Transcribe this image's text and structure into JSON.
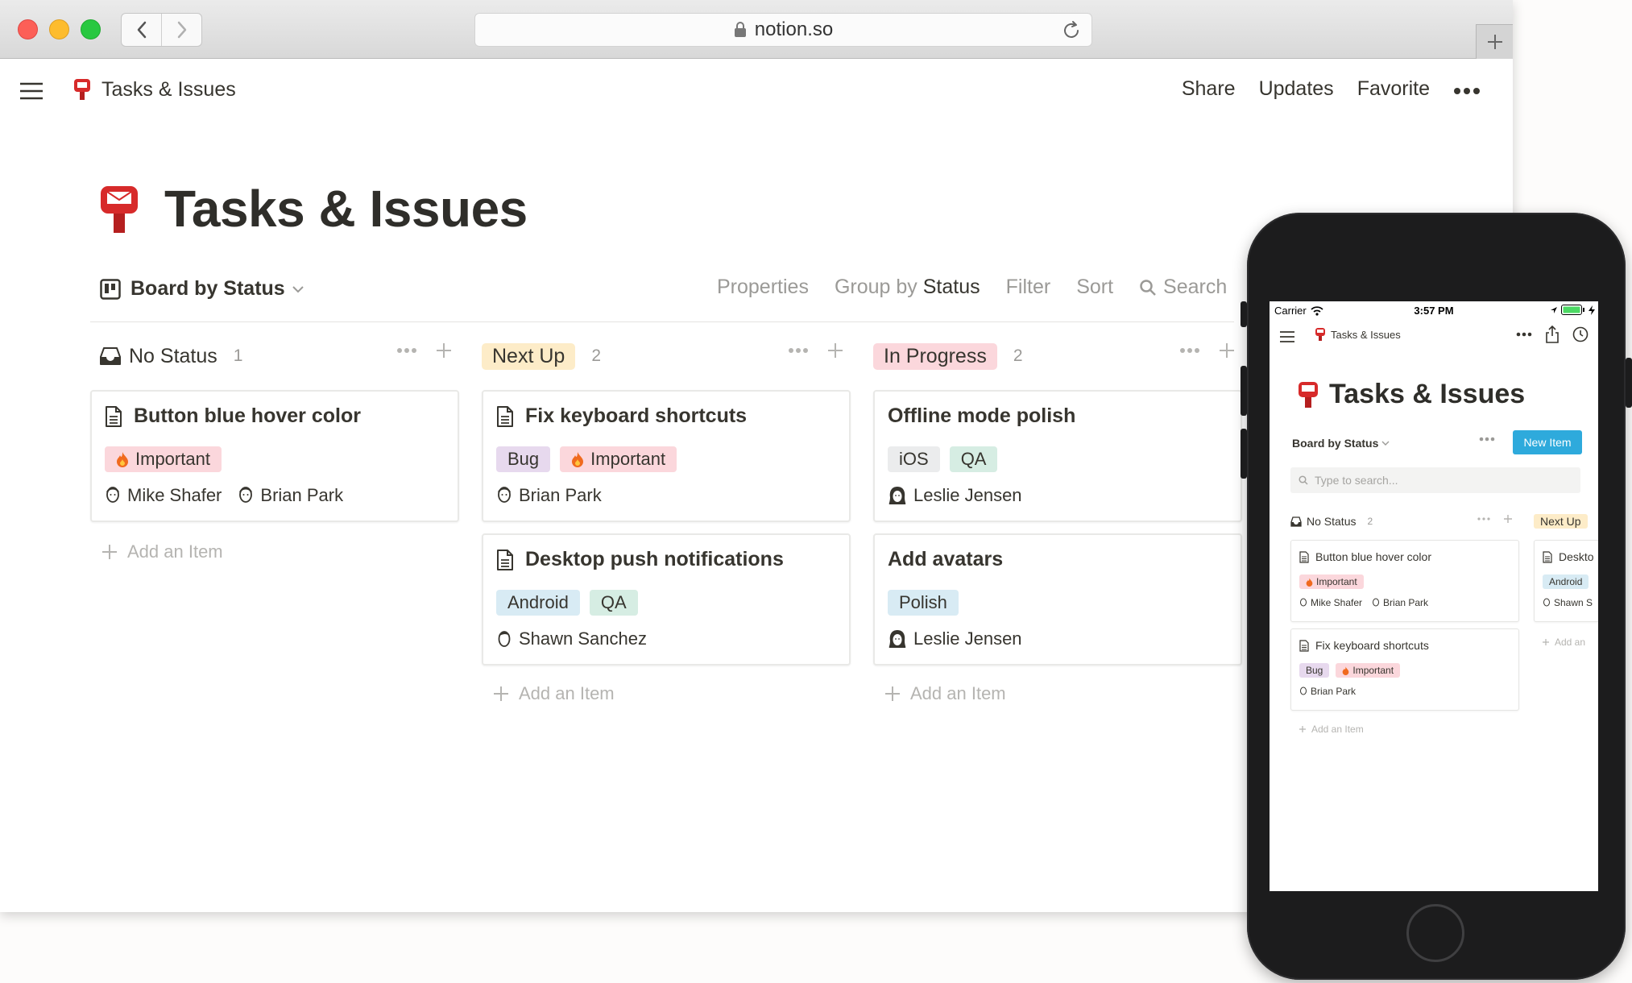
{
  "browser": {
    "url": "notion.so"
  },
  "topbar": {
    "breadcrumb": "Tasks & Issues",
    "share": "Share",
    "updates": "Updates",
    "favorite": "Favorite"
  },
  "page": {
    "title": "Tasks & Issues",
    "icon": "mailbox-icon"
  },
  "view": {
    "name": "Board by Status",
    "properties": "Properties",
    "group_by_prefix": "Group by",
    "group_by_value": "Status",
    "filter": "Filter",
    "sort": "Sort",
    "search": "Search"
  },
  "board": {
    "add_item": "Add an Item",
    "columns": [
      {
        "name": "No Status",
        "count": "1",
        "color": "",
        "cards": [
          {
            "title": "Button blue hover color",
            "icon": true,
            "tags": [
              "Important"
            ],
            "people": [
              "Mike Shafer",
              "Brian Park"
            ]
          }
        ]
      },
      {
        "name": "Next Up",
        "count": "2",
        "color": "#fdecc8",
        "cards": [
          {
            "title": "Fix keyboard shortcuts",
            "icon": true,
            "tags": [
              "Bug",
              "Important"
            ],
            "people": [
              "Brian Park"
            ]
          },
          {
            "title": "Desktop push notifications",
            "icon": true,
            "tags": [
              "Android",
              "QA"
            ],
            "people": [
              "Shawn Sanchez"
            ]
          }
        ]
      },
      {
        "name": "In Progress",
        "count": "2",
        "color": "#fbd7dc",
        "cards": [
          {
            "title": "Offline mode polish",
            "icon": false,
            "tags": [
              "iOS",
              "QA"
            ],
            "people": [
              "Leslie Jensen"
            ]
          },
          {
            "title": "Add avatars",
            "icon": false,
            "tags": [
              "Polish"
            ],
            "people": [
              "Leslie Jensen"
            ]
          }
        ]
      }
    ]
  },
  "mobile": {
    "carrier": "Carrier",
    "time": "3:57 PM",
    "breadcrumb": "Tasks & Issues",
    "title": "Tasks & Issues",
    "view": "Board by Status",
    "new_item": "New Item",
    "search_placeholder": "Type to search...",
    "col1": {
      "name": "No Status",
      "count": "2"
    },
    "col2": {
      "name": "Next Up"
    },
    "card1": {
      "title": "Button blue hover color",
      "tags": [
        "Important"
      ],
      "people": [
        "Mike Shafer",
        "Brian Park"
      ]
    },
    "card2": {
      "title": "Fix keyboard shortcuts",
      "tags": [
        "Bug",
        "Important"
      ],
      "people": [
        "Brian Park"
      ]
    },
    "card3": {
      "title": "Deskto",
      "tags": [
        "Android"
      ],
      "people": [
        "Shawn S"
      ]
    },
    "add_item": "Add an Item",
    "add_item_short": "Add an"
  }
}
